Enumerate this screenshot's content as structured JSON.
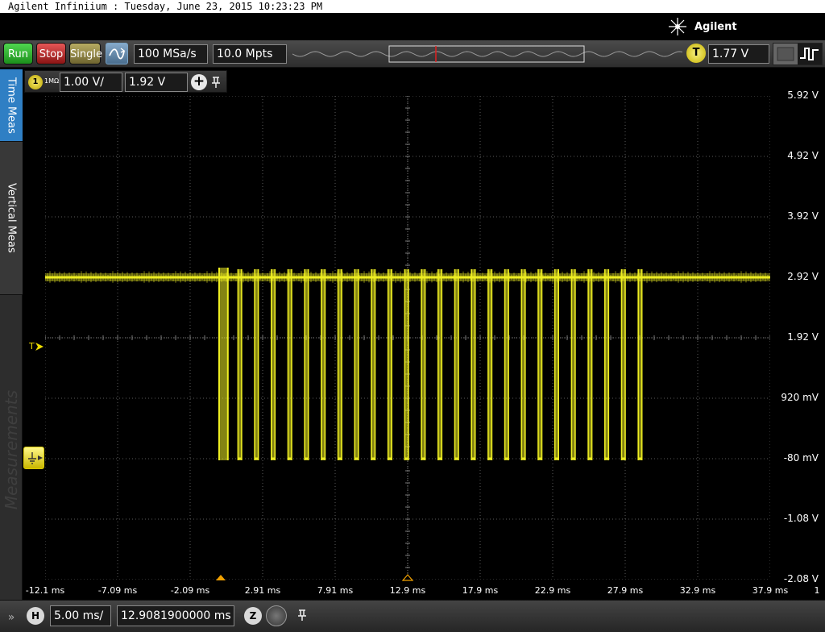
{
  "window": {
    "title": "Agilent Infiniium : Tuesday, June 23, 2015 10:23:23 PM"
  },
  "brand": {
    "name": "Agilent",
    "logo_icon": "agilent-spark-icon"
  },
  "toolbar": {
    "run_label": "Run",
    "stop_label": "Stop",
    "single_label": "Single",
    "autoscale_icon": "autoscale-icon",
    "sample_rate": "100 MSa/s",
    "memory_depth": "10.0 Mpts",
    "trigger_badge": "T",
    "trigger_level": "1.77 V"
  },
  "channel": {
    "number": "1",
    "impedance": "1MΩ",
    "scale": "1.00 V/",
    "offset": "1.92 V",
    "add_icon": "plus-icon",
    "pin_icon": "pin-icon"
  },
  "sidebar": {
    "tabs": [
      {
        "label": "Time Meas"
      },
      {
        "label": "Vertical Meas"
      }
    ],
    "panel_label": "Measurements"
  },
  "markers": {
    "trigger_marker": "T"
  },
  "display": {
    "y_labels": [
      "5.92 V",
      "4.92 V",
      "3.92 V",
      "2.92 V",
      "1.92 V",
      "920 mV",
      "-80 mV",
      "-1.08 V",
      "-2.08 V"
    ],
    "x_labels": [
      "-12.1 ms",
      "-7.09 ms",
      "-2.09 ms",
      "2.91 ms",
      "7.91 ms",
      "12.9 ms",
      "17.9 ms",
      "22.9 ms",
      "27.9 ms",
      "32.9 ms",
      "37.9 ms"
    ],
    "x_corner_label": "1",
    "colors": {
      "trace": "#eeee22",
      "grid": "#5a5a5a",
      "background": "#000000"
    }
  },
  "chart_data": {
    "type": "line",
    "title": "",
    "xlabel": "",
    "ylabel": "",
    "x_unit": "ms",
    "y_unit": "V",
    "xlim": [
      -12.1,
      37.9
    ],
    "ylim": [
      -2.08,
      5.92
    ],
    "grid": true,
    "series": [
      {
        "idle_level_v": 2.92,
        "low_level_v": -0.08,
        "burst_start_ms": -0.1,
        "burst_start_end_ms": 0.5,
        "pulse_times_ms": [
          1.2,
          2.35,
          3.5,
          4.65,
          5.8,
          6.95,
          8.1,
          9.25,
          10.4,
          11.55,
          12.7,
          13.85,
          15.0,
          16.15,
          17.3,
          18.45,
          19.6,
          20.75,
          21.9,
          23.05,
          24.2,
          25.35,
          26.5,
          27.65,
          28.8
        ],
        "pulse_width_ms": 0.25
      }
    ]
  },
  "timebase": {
    "h_badge": "H",
    "scale": "5.00 ms/",
    "position": "12.9081900000 ms",
    "zoom_badge": "Z",
    "pin_icon": "pin-icon",
    "expand_icon": "double-chevron-right-icon"
  }
}
